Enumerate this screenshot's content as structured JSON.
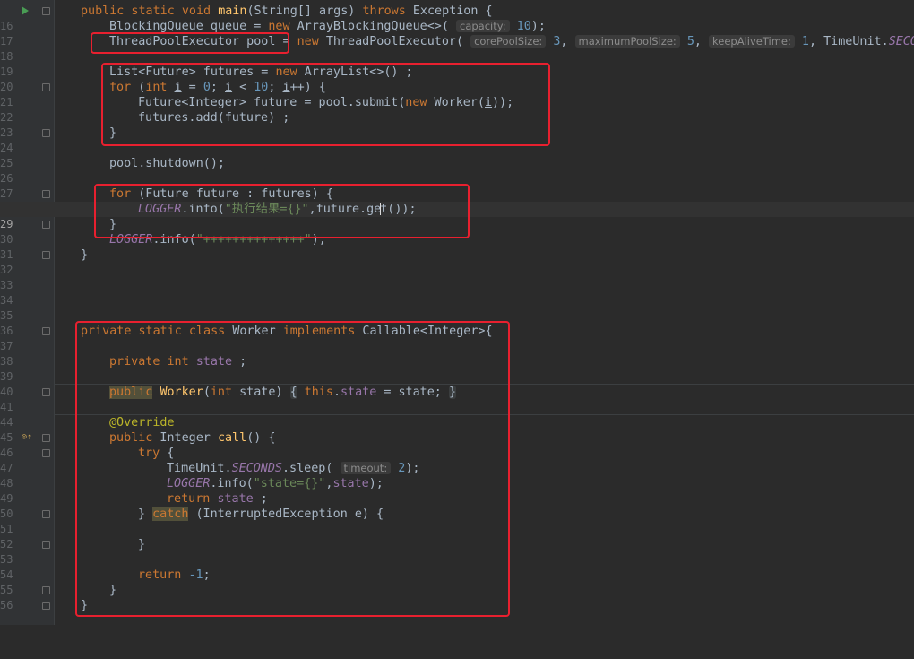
{
  "editor": {
    "line_numbers": [
      "16",
      "17",
      "18",
      "19",
      "20",
      "21",
      "22",
      "23",
      "24",
      "25",
      "26",
      "27",
      "28",
      "29",
      "30",
      "31",
      "32",
      "33",
      "34",
      "35",
      "36",
      "37",
      "38",
      "39",
      "40",
      "41",
      "44",
      "45",
      "46",
      "47",
      "48",
      "49",
      "50",
      "51",
      "52",
      "53",
      "54",
      "55",
      "56"
    ],
    "lines": {
      "l16": {
        "kw1": "public static void ",
        "fn": "main",
        "t1": "(String[] args) ",
        "kw2": "throws",
        "t2": " Exception {"
      },
      "l17": {
        "t1": "BlockingQueue queue = ",
        "kw": "new",
        "t2": " ArrayBlockingQueue<>( ",
        "hint": "capacity:",
        "num": " 10",
        "t3": ");"
      },
      "l18": {
        "t1": "ThreadPoolExecutor pool = ",
        "kw": "new",
        "t2": " ThreadPoolExecutor( ",
        "h1": "corePoolSize:",
        "n1": " 3",
        "c1": ", ",
        "h2": "maximumPoolSize:",
        "n2": " 5",
        "c2": ", ",
        "h3": "keepAliveTime:",
        "n3": " 1",
        "c3": ", TimeUnit.",
        "sf": "SECONDS"
      },
      "l20": {
        "t1": "List<Future> futures = ",
        "kw": "new",
        "t2": " ArrayList<>() ;"
      },
      "l21": {
        "kw1": "for",
        "t1": " (",
        "kw2": "int",
        "t2": " ",
        "v1": "i",
        "t3": " = ",
        "n1": "0",
        "t4": "; ",
        "v2": "i",
        "t5": " < ",
        "n2": "10",
        "t6": "; ",
        "v3": "i",
        "t7": "++) {"
      },
      "l22": {
        "t1": "Future<Integer> future = pool.submit(",
        "kw": "new",
        "t2": " Worker(",
        "v": "i",
        "t3": "));"
      },
      "l23": {
        "t1": "futures.add(future) ;"
      },
      "l24": {
        "t1": "}"
      },
      "l26": {
        "t1": "pool.shutdown();"
      },
      "l28": {
        "kw": "for",
        "t1": " (Future future : futures) {"
      },
      "l29": {
        "sf": "LOGGER",
        "t1": ".info(",
        "str": "\"执行结果={}\"",
        "t2": ",future.ge",
        "t3": "t());"
      },
      "l30": {
        "t1": "}"
      },
      "l31": {
        "sf": "LOGGER",
        "t1": ".info(",
        "str": "\"++++++++++++++\"",
        "t2": ");"
      },
      "l32": {
        "t1": "}"
      },
      "l37": {
        "kw1": "private static class ",
        "t1": "Worker ",
        "kw2": "implements",
        "t2": " Callable<Integer>{"
      },
      "l39": {
        "kw": "private int ",
        "field": "state",
        "t1": " ;"
      },
      "l41": {
        "kw1": "public",
        "t1": " ",
        "fn": "Worker",
        "t2": "(",
        "kw2": "int",
        "t3": " state) ",
        "b1": "{",
        "t4": " ",
        "kw3": "this",
        "t5": ".",
        "field": "state",
        "t6": " = state;",
        "t7": " ",
        "b2": "}"
      },
      "l45": {
        "anno": "@Override"
      },
      "l46": {
        "kw": "public",
        "t1": " Integer ",
        "fn": "call",
        "t2": "() {"
      },
      "l47": {
        "kw": "try",
        "t1": " {"
      },
      "l48": {
        "t1": "TimeUnit.",
        "sf": "SECONDS",
        "t2": ".sleep( ",
        "hint": "timeout:",
        "num": " 2",
        "t3": ");"
      },
      "l49": {
        "sf": "LOGGER",
        "t1": ".info(",
        "str": "\"state={}\"",
        "t2": ",",
        "field": "state",
        "t3": ");"
      },
      "l50": {
        "kw": "return",
        "t1": " ",
        "field": "state",
        "t2": " ;"
      },
      "l51": {
        "t1": "} ",
        "kw": "catch",
        "t2": " (InterruptedException e) {"
      },
      "l53": {
        "t1": "}"
      },
      "l55": {
        "kw": "return",
        "t1": " ",
        "num": "-1",
        "t2": ";"
      },
      "l56": {
        "t1": "}"
      },
      "l57": {
        "t1": "}"
      }
    }
  },
  "colors": {
    "background": "#2b2b2b",
    "keyword": "#cc7832",
    "string": "#6a8759",
    "number": "#6897bb",
    "field": "#9876aa",
    "function": "#ffc66d",
    "annotation": "#bbb529",
    "highlight_box": "#e8202f"
  }
}
